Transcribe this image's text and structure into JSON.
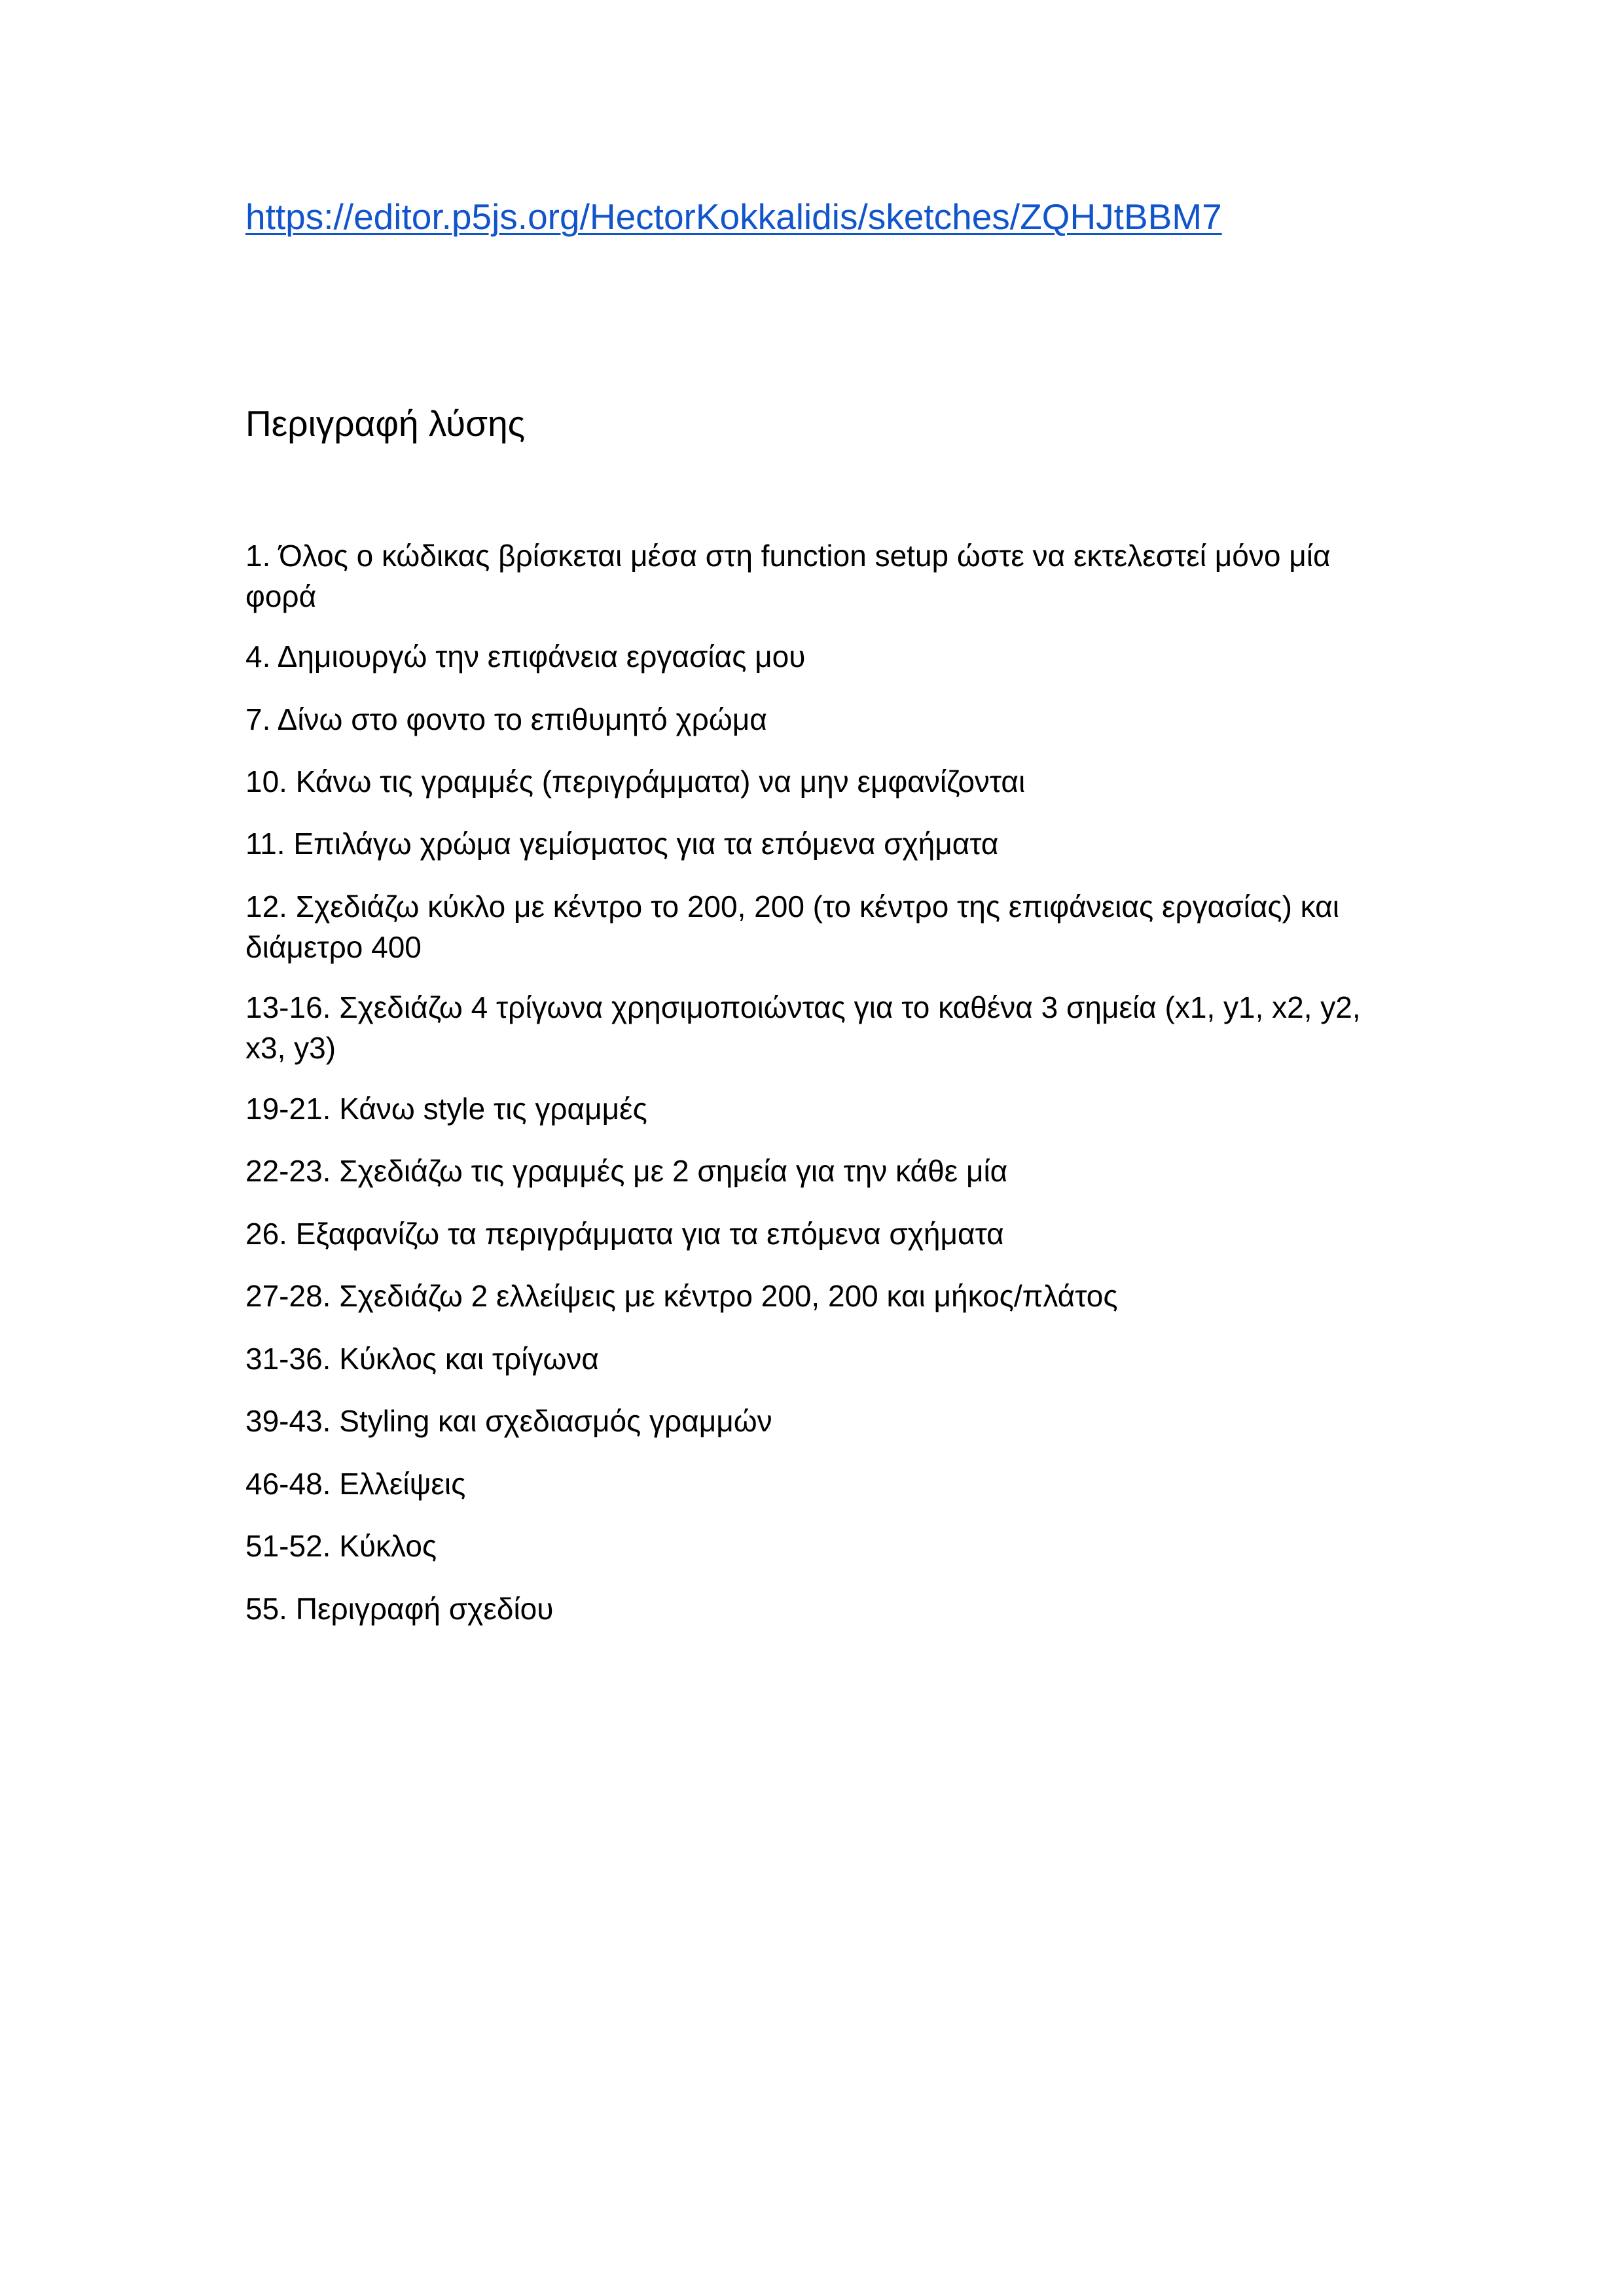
{
  "document": {
    "link": {
      "text": "https://editor.p5js.org/HectorKokkalidis/sketches/ZQHJtBBM7",
      "color": "#1155cc"
    },
    "heading": "Περιγραφή λύσης",
    "items": [
      "1. Όλος ο κώδικας βρίσκεται μέσα στη function setup ώστε να εκτελεστεί μόνο μία φορά",
      "4. Δημιουργώ την επιφάνεια εργασίας μου",
      "7. Δίνω στο φοντο το επιθυμητό χρώμα",
      "10. Κάνω τις γραμμές (περιγράμματα) να μην εμφανίζονται",
      "11. Επιλάγω χρώμα γεμίσματος για τα επόμενα σχήματα",
      "12. Σχεδιάζω κύκλο με κέντρο το 200, 200 (το κέντρο της επιφάνειας εργασίας) και διάμετρο 400",
      "13-16. Σχεδιάζω 4 τρίγωνα χρησιμοποιώντας για το καθένα 3 σημεία (x1, y1, x2, y2, x3, y3)",
      "19-21. Κάνω style τις γραμμές",
      "22-23. Σχεδιάζω τις γραμμές με 2 σημεία για την κάθε μία",
      "26. Εξαφανίζω τα περιγράμματα για τα επόμενα σχήματα",
      "27-28. Σχεδιάζω 2 ελλείψεις με κέντρο 200, 200 και μήκος/πλάτος",
      "31-36. Κύκλος και τρίγωνα",
      "39-43. Styling και σχεδιασμός γραμμών",
      "46-48. Ελλείψεις",
      "51-52. Κύκλος",
      "55. Περιγραφή σχεδίου"
    ]
  }
}
